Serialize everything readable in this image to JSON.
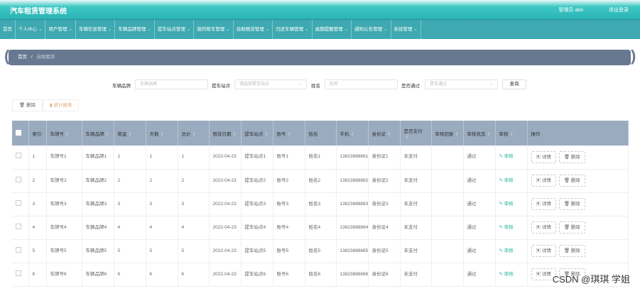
{
  "header": {
    "title": "汽车租赁管理系统",
    "user": "管理员 abo",
    "logout": "退出登录"
  },
  "nav": [
    {
      "label": "首页",
      "dd": false
    },
    {
      "label": "个人中心",
      "dd": true
    },
    {
      "label": "用户管理",
      "dd": true
    },
    {
      "label": "车辆信息管理",
      "dd": true
    },
    {
      "label": "车辆品牌管理",
      "dd": true
    },
    {
      "label": "提车站点管理",
      "dd": true
    },
    {
      "label": "我的租车管理",
      "dd": true
    },
    {
      "label": "自助租赁管理",
      "dd": true
    },
    {
      "label": "归还车辆管理",
      "dd": true
    },
    {
      "label": "逾期提醒管理",
      "dd": true
    },
    {
      "label": "通知公告管理",
      "dd": true
    },
    {
      "label": "系统管理",
      "dd": true
    }
  ],
  "breadcrumb": {
    "home": "首页",
    "sep": "/",
    "current": "自助租赁"
  },
  "search": {
    "brand_label": "车辆品牌",
    "brand_placeholder": "车辆品牌",
    "station_label": "提车站点",
    "station_placeholder": "请选择提车站点",
    "name_label": "姓名",
    "name_placeholder": "姓名",
    "pass_label": "是否通过",
    "pass_placeholder": "是否通过",
    "query": "查询"
  },
  "actions": {
    "delete": "删除",
    "report": "统计报表"
  },
  "table": {
    "headers": [
      "索引",
      "车牌号",
      "车辆品牌",
      "租金",
      "天数",
      "总价",
      "租赁日期",
      "提车站点",
      "账号",
      "姓名",
      "手机",
      "身份证",
      "是否支付",
      "审核回复",
      "审核状态",
      "审核",
      "操作"
    ],
    "audit_label": "审核",
    "detail_label": "详情",
    "delete_label": "删除",
    "rows": [
      [
        "1",
        "车牌号1",
        "车辆品牌1",
        "1",
        "1",
        "1",
        "2022-04-23",
        "提车站点1",
        "账号1",
        "姓名1",
        "13823888881",
        "身份证1",
        "未支付",
        "",
        "通过"
      ],
      [
        "2",
        "车牌号2",
        "车辆品牌2",
        "2",
        "2",
        "2",
        "2022-04-23",
        "提车站点2",
        "账号2",
        "姓名2",
        "13823888882",
        "身份证2",
        "未支付",
        "",
        "通过"
      ],
      [
        "3",
        "车牌号3",
        "车辆品牌3",
        "3",
        "3",
        "3",
        "2022-04-23",
        "提车站点3",
        "账号3",
        "姓名3",
        "13823888883",
        "身份证3",
        "未支付",
        "",
        "通过"
      ],
      [
        "4",
        "车牌号4",
        "车辆品牌4",
        "4",
        "4",
        "4",
        "2022-04-23",
        "提车站点4",
        "账号4",
        "姓名4",
        "13823888884",
        "身份证4",
        "未支付",
        "",
        "通过"
      ],
      [
        "5",
        "车牌号5",
        "车辆品牌5",
        "5",
        "5",
        "5",
        "2022-04-23",
        "提车站点5",
        "账号5",
        "姓名5",
        "13823888885",
        "身份证5",
        "未支付",
        "",
        "通过"
      ],
      [
        "6",
        "车牌号6",
        "车辆品牌6",
        "6",
        "6",
        "6",
        "2022-04-23",
        "提车站点6",
        "账号6",
        "姓名6",
        "13823888886",
        "身份证6",
        "未支付",
        "",
        "通过"
      ]
    ]
  },
  "watermark": "CSDN @琪琪 学姐"
}
